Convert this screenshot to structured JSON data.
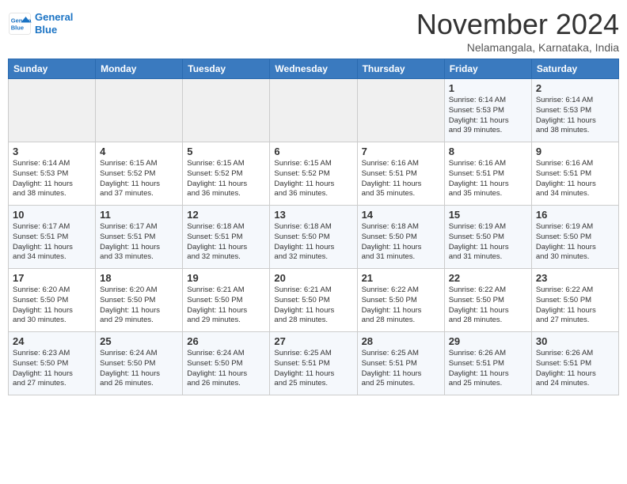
{
  "header": {
    "logo_line1": "General",
    "logo_line2": "Blue",
    "month_title": "November 2024",
    "location": "Nelamangala, Karnataka, India"
  },
  "weekdays": [
    "Sunday",
    "Monday",
    "Tuesday",
    "Wednesday",
    "Thursday",
    "Friday",
    "Saturday"
  ],
  "weeks": [
    [
      {
        "day": "",
        "info": ""
      },
      {
        "day": "",
        "info": ""
      },
      {
        "day": "",
        "info": ""
      },
      {
        "day": "",
        "info": ""
      },
      {
        "day": "",
        "info": ""
      },
      {
        "day": "1",
        "info": "Sunrise: 6:14 AM\nSunset: 5:53 PM\nDaylight: 11 hours\nand 39 minutes."
      },
      {
        "day": "2",
        "info": "Sunrise: 6:14 AM\nSunset: 5:53 PM\nDaylight: 11 hours\nand 38 minutes."
      }
    ],
    [
      {
        "day": "3",
        "info": "Sunrise: 6:14 AM\nSunset: 5:53 PM\nDaylight: 11 hours\nand 38 minutes."
      },
      {
        "day": "4",
        "info": "Sunrise: 6:15 AM\nSunset: 5:52 PM\nDaylight: 11 hours\nand 37 minutes."
      },
      {
        "day": "5",
        "info": "Sunrise: 6:15 AM\nSunset: 5:52 PM\nDaylight: 11 hours\nand 36 minutes."
      },
      {
        "day": "6",
        "info": "Sunrise: 6:15 AM\nSunset: 5:52 PM\nDaylight: 11 hours\nand 36 minutes."
      },
      {
        "day": "7",
        "info": "Sunrise: 6:16 AM\nSunset: 5:51 PM\nDaylight: 11 hours\nand 35 minutes."
      },
      {
        "day": "8",
        "info": "Sunrise: 6:16 AM\nSunset: 5:51 PM\nDaylight: 11 hours\nand 35 minutes."
      },
      {
        "day": "9",
        "info": "Sunrise: 6:16 AM\nSunset: 5:51 PM\nDaylight: 11 hours\nand 34 minutes."
      }
    ],
    [
      {
        "day": "10",
        "info": "Sunrise: 6:17 AM\nSunset: 5:51 PM\nDaylight: 11 hours\nand 34 minutes."
      },
      {
        "day": "11",
        "info": "Sunrise: 6:17 AM\nSunset: 5:51 PM\nDaylight: 11 hours\nand 33 minutes."
      },
      {
        "day": "12",
        "info": "Sunrise: 6:18 AM\nSunset: 5:51 PM\nDaylight: 11 hours\nand 32 minutes."
      },
      {
        "day": "13",
        "info": "Sunrise: 6:18 AM\nSunset: 5:50 PM\nDaylight: 11 hours\nand 32 minutes."
      },
      {
        "day": "14",
        "info": "Sunrise: 6:18 AM\nSunset: 5:50 PM\nDaylight: 11 hours\nand 31 minutes."
      },
      {
        "day": "15",
        "info": "Sunrise: 6:19 AM\nSunset: 5:50 PM\nDaylight: 11 hours\nand 31 minutes."
      },
      {
        "day": "16",
        "info": "Sunrise: 6:19 AM\nSunset: 5:50 PM\nDaylight: 11 hours\nand 30 minutes."
      }
    ],
    [
      {
        "day": "17",
        "info": "Sunrise: 6:20 AM\nSunset: 5:50 PM\nDaylight: 11 hours\nand 30 minutes."
      },
      {
        "day": "18",
        "info": "Sunrise: 6:20 AM\nSunset: 5:50 PM\nDaylight: 11 hours\nand 29 minutes."
      },
      {
        "day": "19",
        "info": "Sunrise: 6:21 AM\nSunset: 5:50 PM\nDaylight: 11 hours\nand 29 minutes."
      },
      {
        "day": "20",
        "info": "Sunrise: 6:21 AM\nSunset: 5:50 PM\nDaylight: 11 hours\nand 28 minutes."
      },
      {
        "day": "21",
        "info": "Sunrise: 6:22 AM\nSunset: 5:50 PM\nDaylight: 11 hours\nand 28 minutes."
      },
      {
        "day": "22",
        "info": "Sunrise: 6:22 AM\nSunset: 5:50 PM\nDaylight: 11 hours\nand 28 minutes."
      },
      {
        "day": "23",
        "info": "Sunrise: 6:22 AM\nSunset: 5:50 PM\nDaylight: 11 hours\nand 27 minutes."
      }
    ],
    [
      {
        "day": "24",
        "info": "Sunrise: 6:23 AM\nSunset: 5:50 PM\nDaylight: 11 hours\nand 27 minutes."
      },
      {
        "day": "25",
        "info": "Sunrise: 6:24 AM\nSunset: 5:50 PM\nDaylight: 11 hours\nand 26 minutes."
      },
      {
        "day": "26",
        "info": "Sunrise: 6:24 AM\nSunset: 5:50 PM\nDaylight: 11 hours\nand 26 minutes."
      },
      {
        "day": "27",
        "info": "Sunrise: 6:25 AM\nSunset: 5:51 PM\nDaylight: 11 hours\nand 25 minutes."
      },
      {
        "day": "28",
        "info": "Sunrise: 6:25 AM\nSunset: 5:51 PM\nDaylight: 11 hours\nand 25 minutes."
      },
      {
        "day": "29",
        "info": "Sunrise: 6:26 AM\nSunset: 5:51 PM\nDaylight: 11 hours\nand 25 minutes."
      },
      {
        "day": "30",
        "info": "Sunrise: 6:26 AM\nSunset: 5:51 PM\nDaylight: 11 hours\nand 24 minutes."
      }
    ]
  ]
}
